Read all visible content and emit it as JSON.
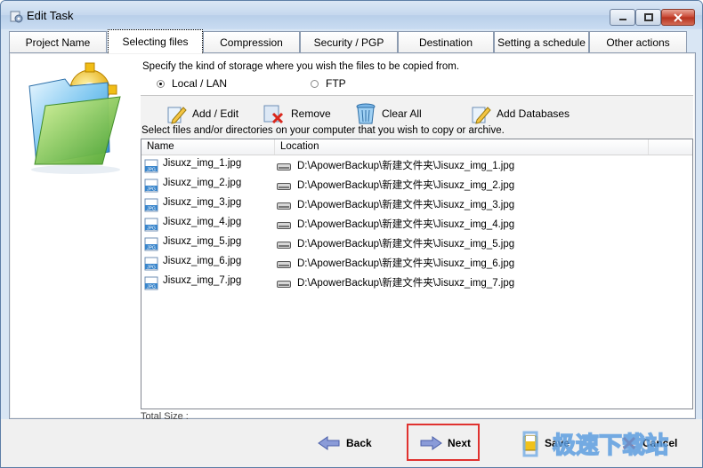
{
  "window": {
    "title": "Edit Task"
  },
  "tabs": [
    {
      "label": "Project Name"
    },
    {
      "label": "Selecting files"
    },
    {
      "label": "Compression"
    },
    {
      "label": "Security / PGP"
    },
    {
      "label": "Destination"
    },
    {
      "label": "Setting a schedule"
    },
    {
      "label": "Other actions"
    }
  ],
  "storage": {
    "instruction": "Specify the kind of storage where you wish the files to be copied from.",
    "options": [
      {
        "label": "Local / LAN",
        "selected": true
      },
      {
        "label": "FTP",
        "selected": false
      }
    ]
  },
  "toolbar": {
    "add_edit": "Add / Edit",
    "remove": "Remove",
    "clear_all": "Clear All",
    "add_databases": "Add Databases"
  },
  "select_instruction": "Select files and/or directories on your computer that you wish to copy or archive.",
  "list": {
    "columns": [
      "Name",
      "Location"
    ],
    "rows": [
      {
        "name": "Jisuxz_img_1.jpg",
        "location": "D:\\ApowerBackup\\新建文件夹\\Jisuxz_img_1.jpg"
      },
      {
        "name": "Jisuxz_img_2.jpg",
        "location": "D:\\ApowerBackup\\新建文件夹\\Jisuxz_img_2.jpg"
      },
      {
        "name": "Jisuxz_img_3.jpg",
        "location": "D:\\ApowerBackup\\新建文件夹\\Jisuxz_img_3.jpg"
      },
      {
        "name": "Jisuxz_img_4.jpg",
        "location": "D:\\ApowerBackup\\新建文件夹\\Jisuxz_img_4.jpg"
      },
      {
        "name": "Jisuxz_img_5.jpg",
        "location": "D:\\ApowerBackup\\新建文件夹\\Jisuxz_img_5.jpg"
      },
      {
        "name": "Jisuxz_img_6.jpg",
        "location": "D:\\ApowerBackup\\新建文件夹\\Jisuxz_img_6.jpg"
      },
      {
        "name": "Jisuxz_img_7.jpg",
        "location": "D:\\ApowerBackup\\新建文件夹\\Jisuxz_img_7.jpg"
      }
    ],
    "total_size_label": "Total Size :"
  },
  "buttons": {
    "back": "Back",
    "next": "Next",
    "save": "Save",
    "cancel": "Cancel"
  },
  "file_icon_text": "JPG",
  "watermark": "极速下载站",
  "colors": {
    "accent": "#3c7fd1",
    "highlight": "#e0322f"
  }
}
